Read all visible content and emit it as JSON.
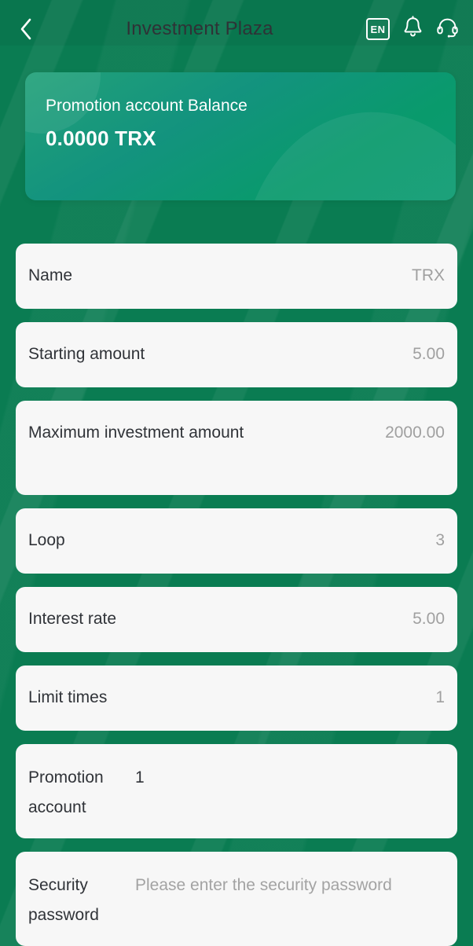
{
  "header": {
    "back_icon": "chevron-left-icon",
    "title": "Investment Plaza",
    "language_label": "EN",
    "bell_icon": "bell-icon",
    "support_icon": "headset-icon"
  },
  "balance_card": {
    "label": "Promotion account Balance",
    "amount": "0.0000 TRX"
  },
  "rows": [
    {
      "label": "Name",
      "value": "TRX"
    },
    {
      "label": "Starting amount",
      "value": "5.00"
    },
    {
      "label": "Maximum investment amount",
      "value": "2000.00"
    },
    {
      "label": "Loop",
      "value": "3"
    },
    {
      "label": "Interest rate",
      "value": "5.00"
    },
    {
      "label": "Limit times",
      "value": "1"
    }
  ],
  "promotion_account": {
    "label": "Promotion account",
    "value": "1"
  },
  "security_password": {
    "label": "Security password",
    "placeholder": "Please enter the security password",
    "value": ""
  },
  "colors": {
    "background_green": "#0a7c52",
    "card_green": "#13937e",
    "row_background": "#f7f7f7",
    "label_text": "#303338",
    "value_text": "#a0a0a0",
    "title_text": "#2f3236"
  }
}
